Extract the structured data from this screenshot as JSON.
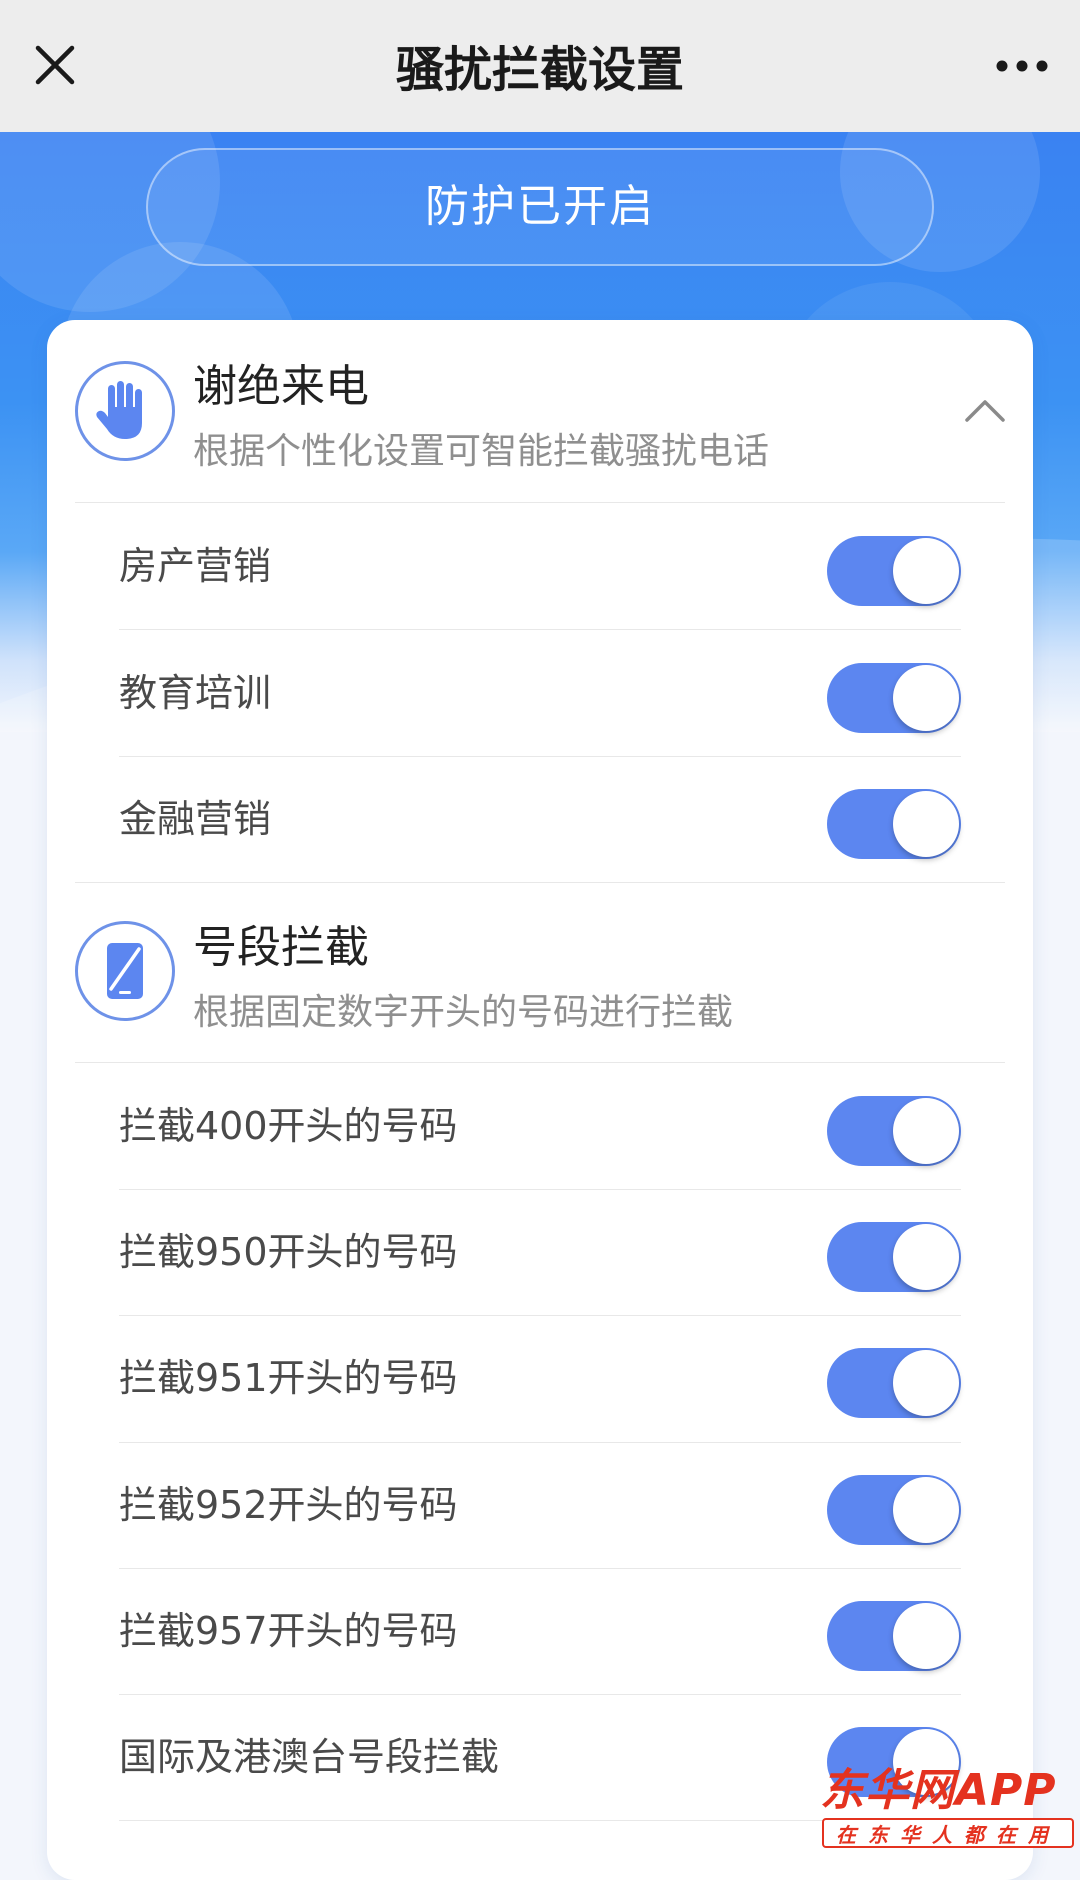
{
  "header": {
    "title": "骚扰拦截设置"
  },
  "hero": {
    "status_text": "防护已开启"
  },
  "sections": [
    {
      "title": "谢绝来电",
      "subtitle": "根据个性化设置可智能拦截骚扰电话",
      "icon": "hand-stop-icon",
      "collapsible": true,
      "items": [
        {
          "label": "房产营销",
          "enabled": true
        },
        {
          "label": "教育培训",
          "enabled": true
        },
        {
          "label": "金融营销",
          "enabled": true
        }
      ]
    },
    {
      "title": "号段拦截",
      "subtitle": "根据固定数字开头的号码进行拦截",
      "icon": "phone-blocked-icon",
      "collapsible": false,
      "items": [
        {
          "label": "拦截400开头的号码",
          "enabled": true
        },
        {
          "label": "拦截950开头的号码",
          "enabled": true
        },
        {
          "label": "拦截951开头的号码",
          "enabled": true
        },
        {
          "label": "拦截952开头的号码",
          "enabled": true
        },
        {
          "label": "拦截957开头的号码",
          "enabled": true
        },
        {
          "label": "国际及港澳台号段拦截",
          "enabled": true
        }
      ]
    }
  ],
  "watermark": {
    "logo_text": "东华网APP",
    "slogan": "在东华人都在用"
  },
  "colors": {
    "accent": "#5c86f0",
    "hero_blue": "#3a8af2",
    "watermark_red": "#e4321f"
  }
}
